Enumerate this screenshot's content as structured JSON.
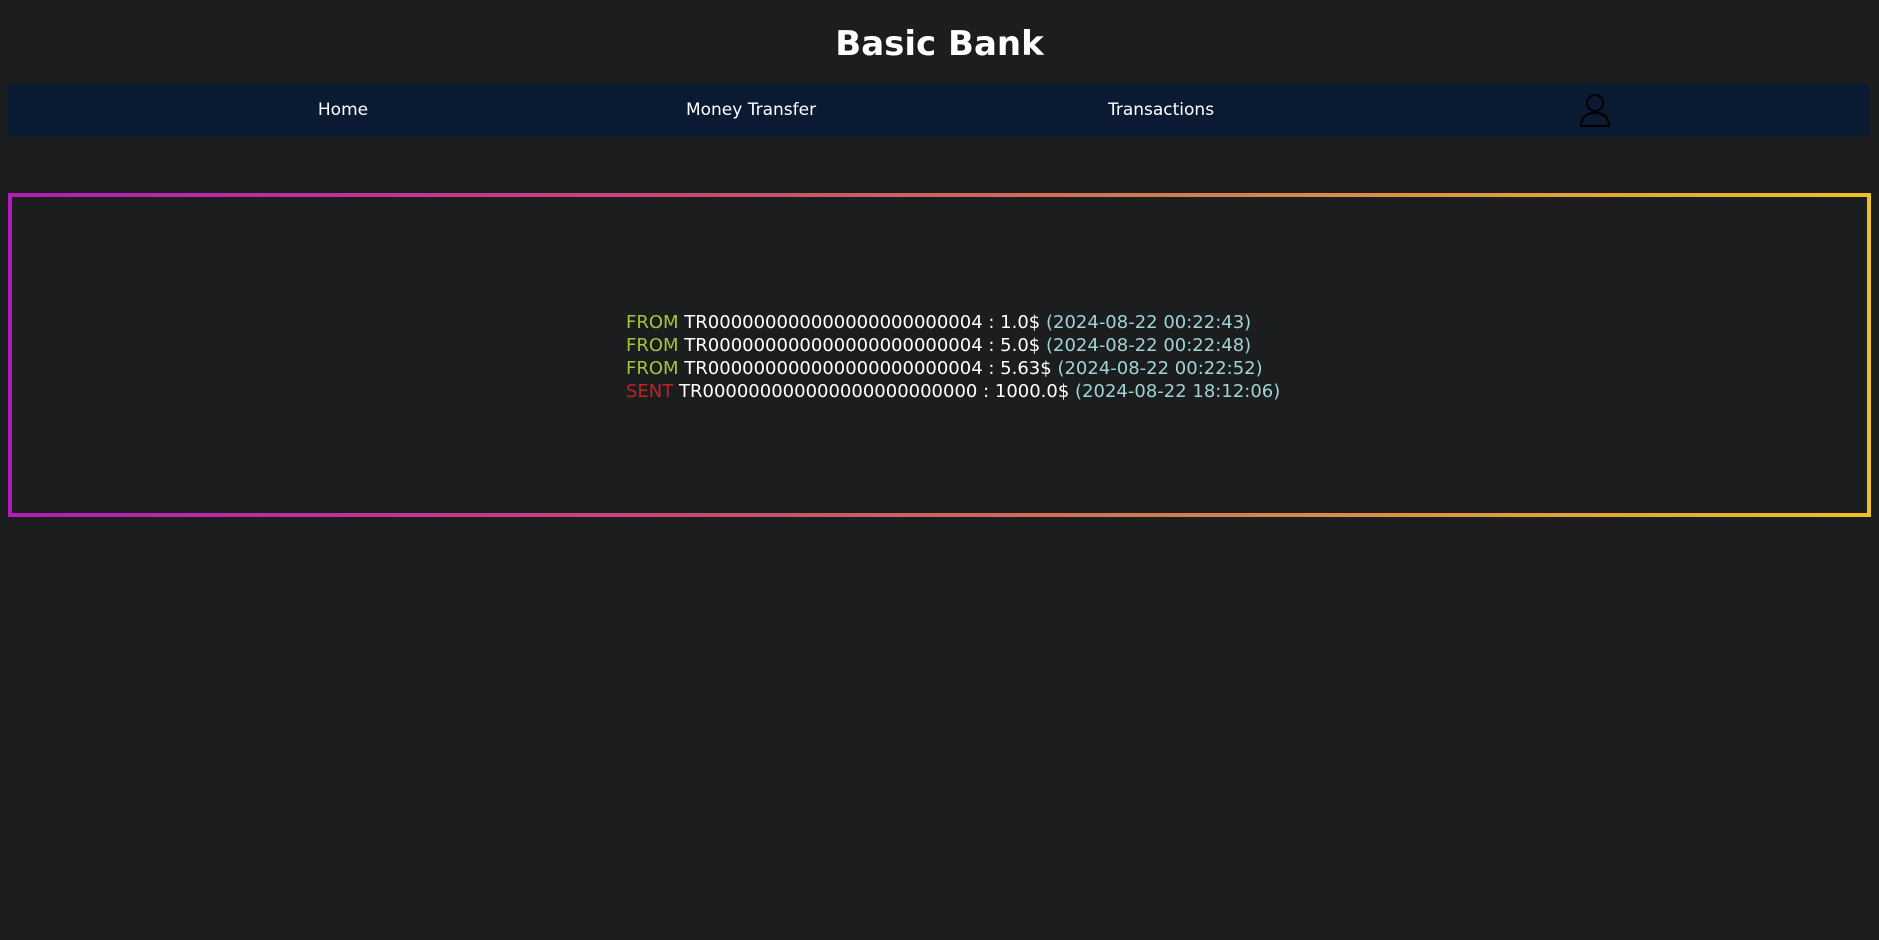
{
  "app": {
    "title": "Basic Bank"
  },
  "nav": {
    "items": [
      {
        "label": "Home"
      },
      {
        "label": "Money Transfer"
      },
      {
        "label": "Transactions"
      }
    ],
    "profile_icon": "user-icon"
  },
  "transactions": [
    {
      "direction": "FROM",
      "account": "TR000000000000000000000004",
      "sep": " : ",
      "amount": "1.0$",
      "time": "(2024-08-22 00:22:43)"
    },
    {
      "direction": "FROM",
      "account": "TR000000000000000000000004",
      "sep": " : ",
      "amount": "5.0$",
      "time": "(2024-08-22 00:22:48)"
    },
    {
      "direction": "FROM",
      "account": "TR000000000000000000000004",
      "sep": " : ",
      "amount": "5.63$",
      "time": "(2024-08-22 00:22:52)"
    },
    {
      "direction": "SENT",
      "account": "TR000000000000000000000000",
      "sep": " : ",
      "amount": "1000.0$",
      "time": "(2024-08-22 18:12:06)"
    }
  ],
  "colors": {
    "background": "#1c1d1f",
    "navbar": "#0a1a33",
    "from": "#a6c43a",
    "sent": "#c22222",
    "timestamp": "#9fd3d6",
    "border_start": "#b51bb9",
    "border_end": "#eec024"
  }
}
